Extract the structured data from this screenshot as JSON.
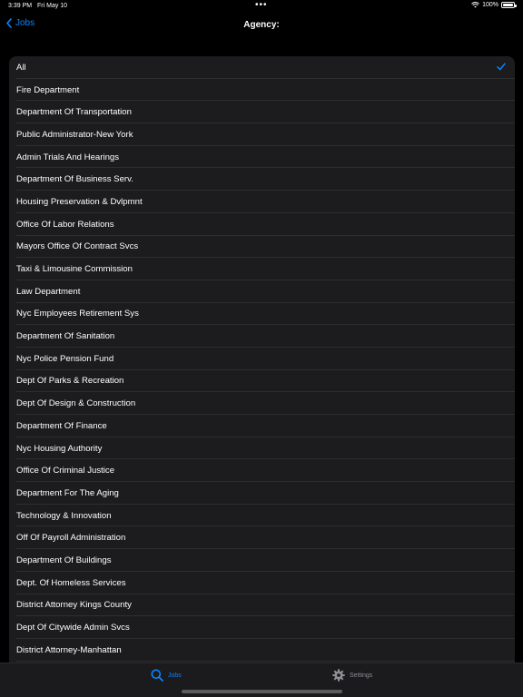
{
  "status": {
    "time": "3:39 PM",
    "date": "Fri May 10",
    "dots": "•••",
    "battery": "100%"
  },
  "nav": {
    "back_label": "Jobs",
    "title": "Agency:"
  },
  "list": {
    "items": [
      "All",
      "Fire Department",
      "Department Of Transportation",
      "Public Administrator-New York",
      "Admin Trials And Hearings",
      "Department Of Business Serv.",
      "Housing Preservation & Dvlpmnt",
      "Office Of Labor Relations",
      "Mayors Office Of Contract Svcs",
      "Taxi & Limousine Commission",
      "Law Department",
      "Nyc Employees Retirement Sys",
      "Department Of Sanitation",
      "Nyc Police Pension Fund",
      "Dept Of Parks & Recreation",
      "Dept Of Design & Construction",
      "Department Of Finance",
      "Nyc Housing Authority",
      "Office Of Criminal Justice",
      "Department For The Aging",
      "Technology & Innovation",
      "Off Of Payroll Administration",
      "Department Of Buildings",
      "Dept. Of Homeless Services",
      "District Attorney Kings County",
      "Dept Of Citywide Admin Svcs",
      "District Attorney-Manhattan"
    ],
    "selected": "All"
  },
  "tabs": {
    "jobs_label": "Jobs",
    "settings_label": "Settings"
  },
  "colors": {
    "accent": "#0a84ff",
    "background": "#000000",
    "list_background": "#1c1c1e"
  }
}
